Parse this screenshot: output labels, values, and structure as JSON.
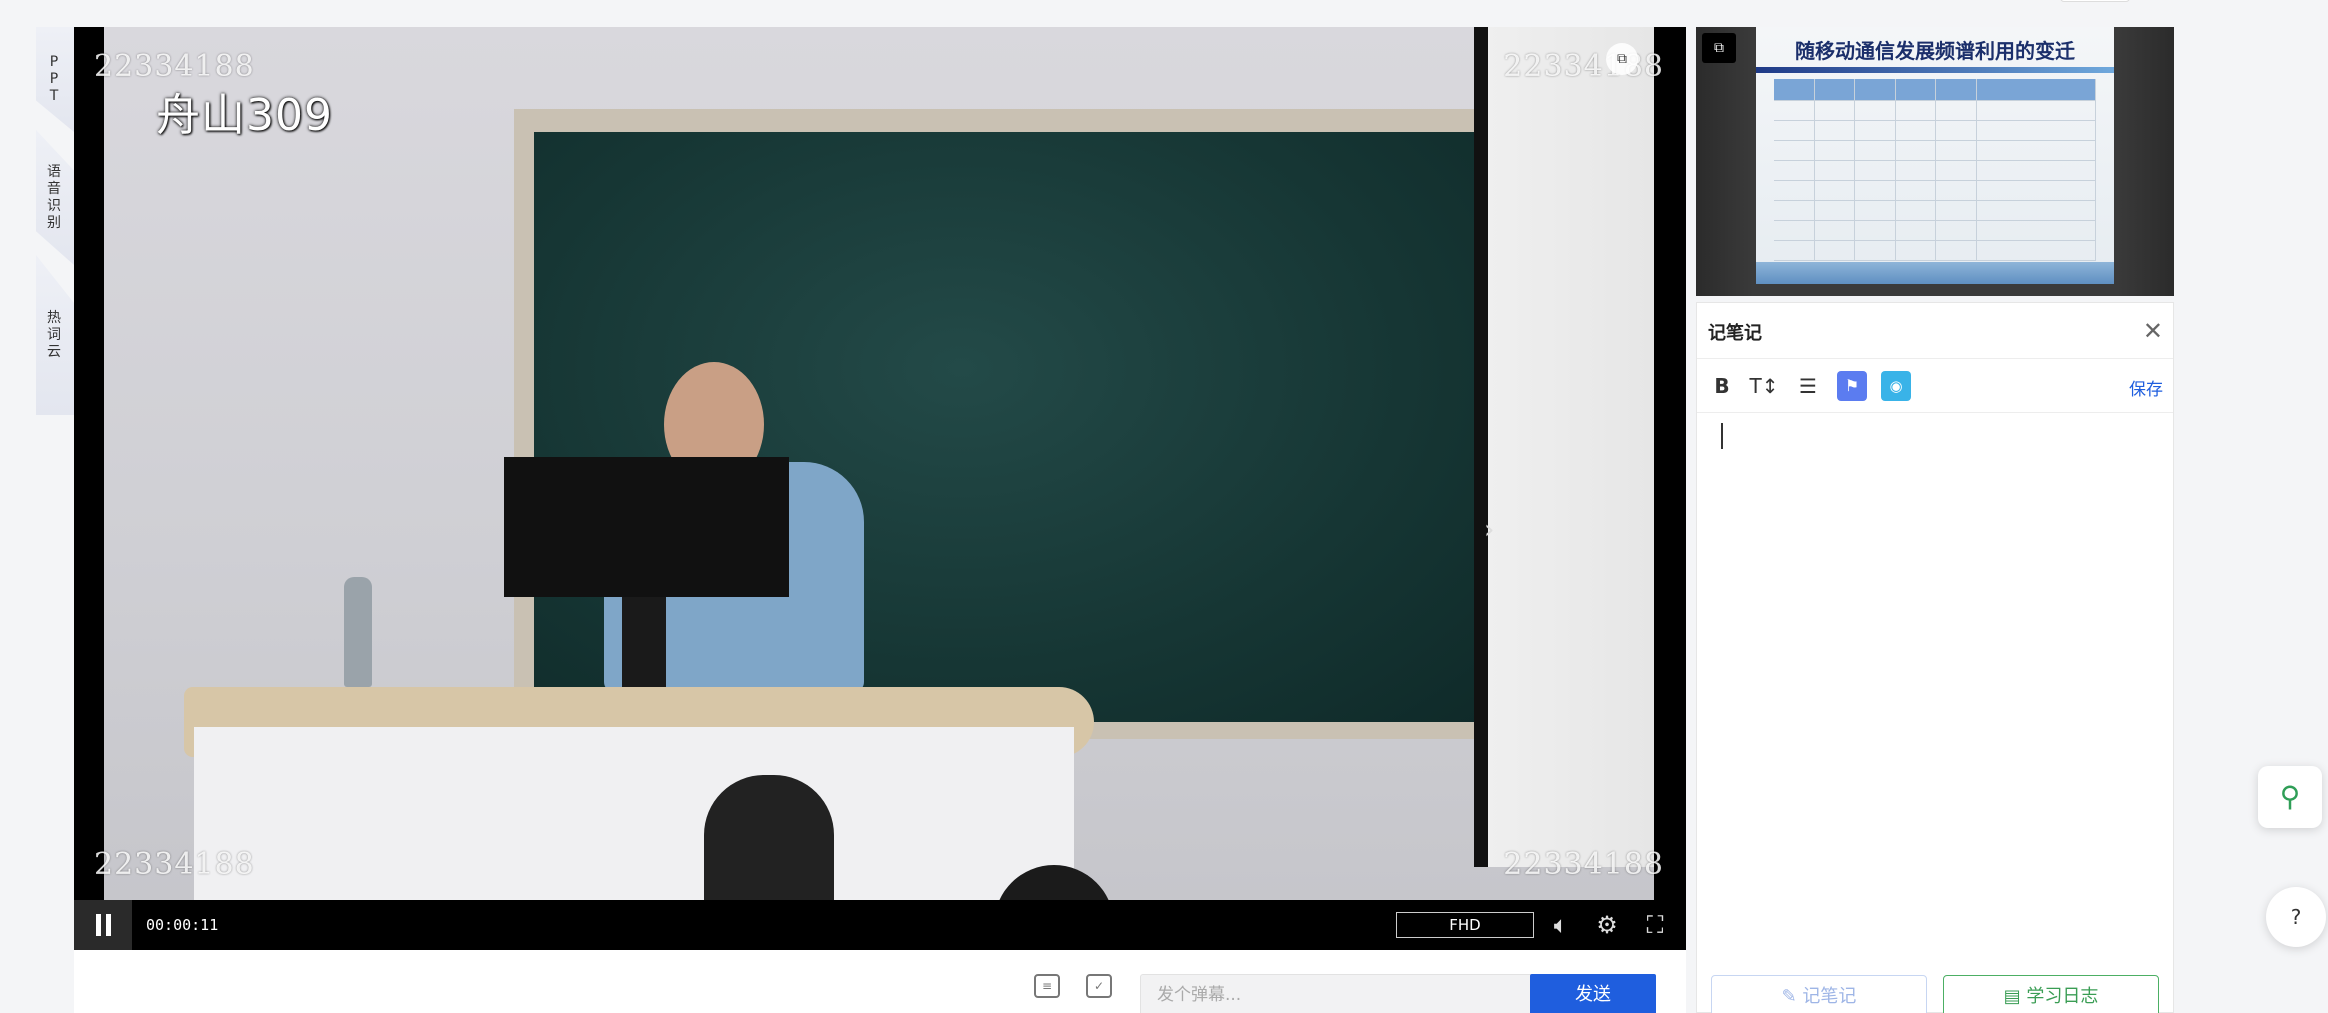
{
  "side_tabs": [
    {
      "label_chars": [
        "P",
        "P",
        "T"
      ]
    },
    {
      "label_chars": [
        "语",
        "音",
        "识",
        "别"
      ]
    },
    {
      "label_chars": [
        "热",
        "词",
        "云"
      ]
    }
  ],
  "video": {
    "watermark": "22334188",
    "room_label": "舟山309",
    "time": "00:00:11",
    "quality": "FHD"
  },
  "danmaku": {
    "placeholder": "发个弹幕...",
    "send_label": "发送"
  },
  "ppt_preview": {
    "slide_title": "随移动通信发展频谱利用的变迁"
  },
  "notes": {
    "title": "记笔记",
    "save_label": "保存",
    "footer_note_label": "记笔记",
    "footer_log_label": "学习日志"
  },
  "colors": {
    "accent_blue": "#1f5ede",
    "green": "#3a9d54",
    "flag_button": "#5b7cf0",
    "camera_button": "#39b3e8"
  }
}
